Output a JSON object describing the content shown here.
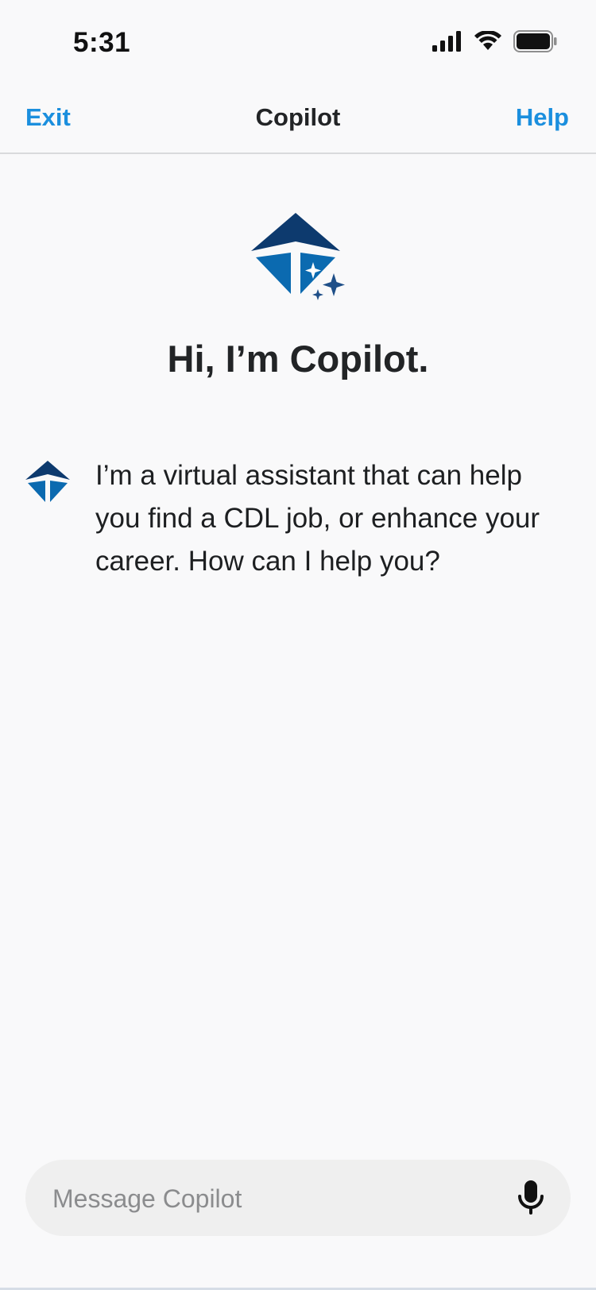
{
  "status_bar": {
    "time": "5:31"
  },
  "nav": {
    "exit_label": "Exit",
    "title": "Copilot",
    "help_label": "Help"
  },
  "hero": {
    "title": "Hi, I’m Copilot."
  },
  "messages": [
    {
      "sender": "bot",
      "text": "I’m a virtual assistant that can help you find a CDL job, or enhance your career. How can I help you?"
    }
  ],
  "composer": {
    "placeholder": "Message Copilot",
    "value": ""
  },
  "colors": {
    "accent": "#1b8fde",
    "logo_dark": "#0d3a6e",
    "logo_blue": "#0b6ab0",
    "background": "#f9f9fa",
    "input_background": "#efefef"
  },
  "icons": {
    "signal": "cellular-signal-icon",
    "wifi": "wifi-icon",
    "battery": "battery-icon",
    "logo": "copilot-logo-icon",
    "avatar": "copilot-avatar-icon",
    "mic": "microphone-icon"
  }
}
